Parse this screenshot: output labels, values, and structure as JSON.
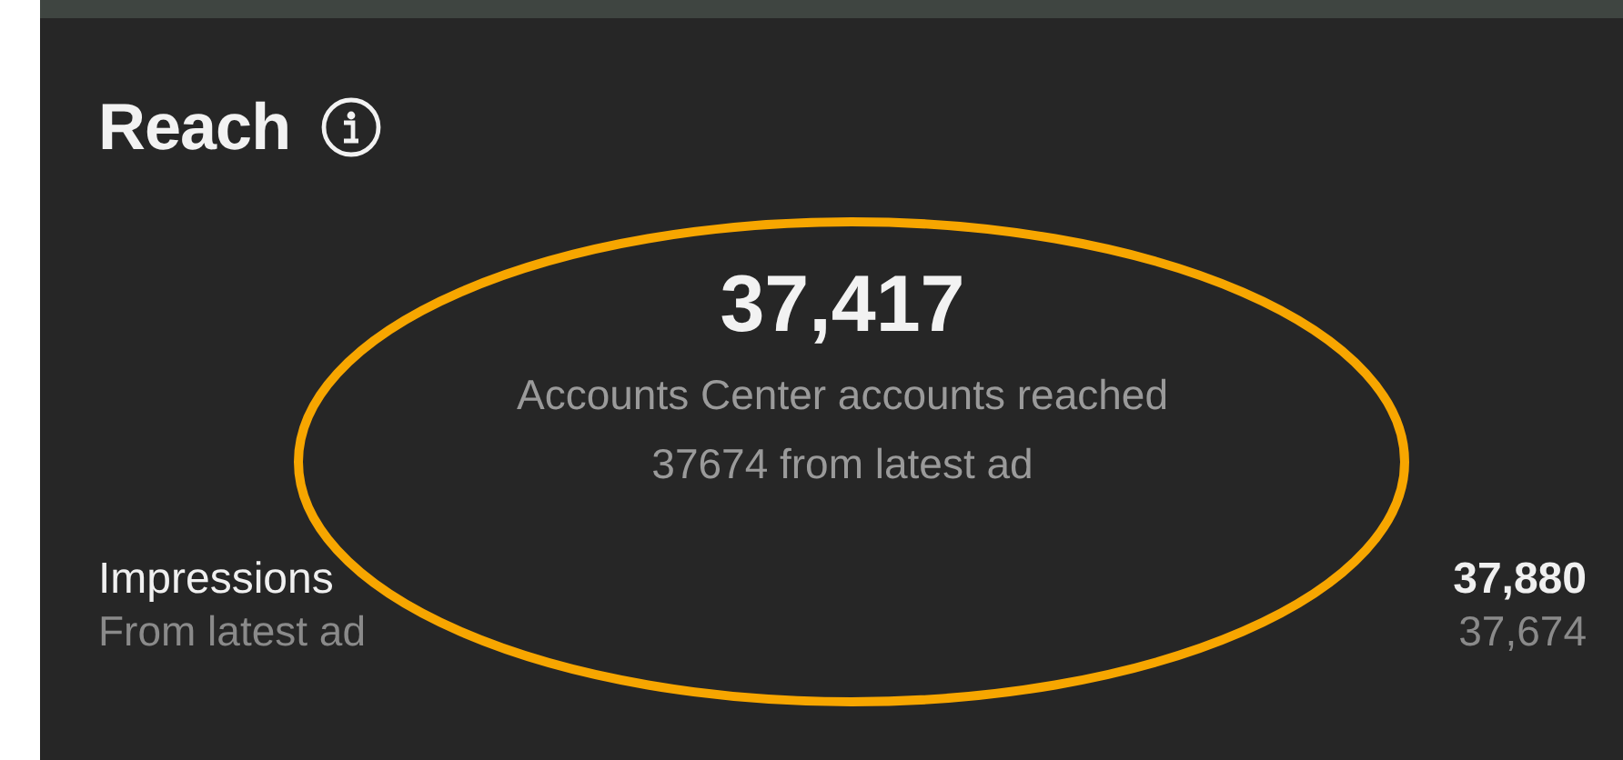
{
  "card": {
    "title": "Reach",
    "value": "37,417",
    "caption": "Accounts Center accounts reached",
    "note": "37674 from latest ad",
    "metrics": [
      {
        "label": "Impressions",
        "sublabel": "From latest ad",
        "value": "37,880",
        "subvalue": "37,674"
      }
    ]
  }
}
